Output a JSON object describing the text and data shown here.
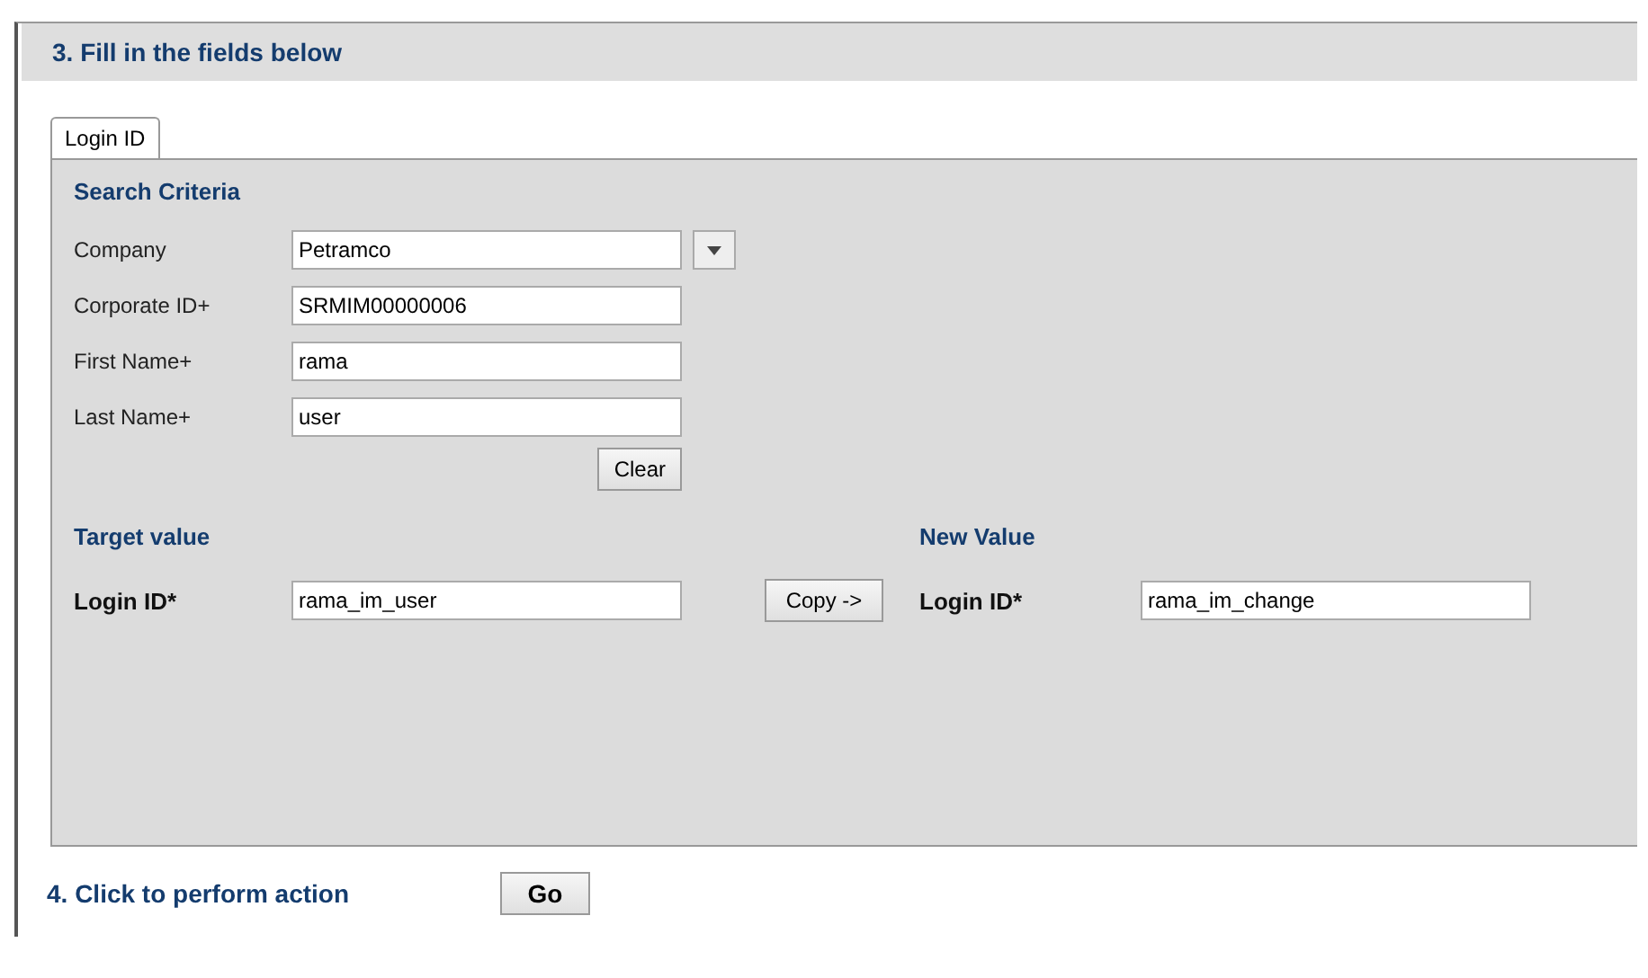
{
  "section_title": "3. Fill in the fields below",
  "tabs": [
    {
      "label": "Login ID",
      "selected": true
    }
  ],
  "search_criteria": {
    "heading": "Search Criteria",
    "fields": [
      {
        "label": "Company",
        "value": "Petramco",
        "kind": "dropdown"
      },
      {
        "label": "Corporate ID+",
        "value": "SRMIM00000006",
        "kind": "text"
      },
      {
        "label": "First Name+",
        "value": "rama",
        "kind": "text"
      },
      {
        "label": "Last Name+",
        "value": "user",
        "kind": "text"
      }
    ],
    "clear_button": "Clear"
  },
  "target_value": {
    "heading": "Target value",
    "label": "Login ID*",
    "value": "rama_im_user"
  },
  "copy_button": "Copy ->",
  "new_value": {
    "heading": "New Value",
    "label": "Login ID*",
    "value": "rama_im_change"
  },
  "action": {
    "label": "4. Click to perform action",
    "button": "Go"
  }
}
